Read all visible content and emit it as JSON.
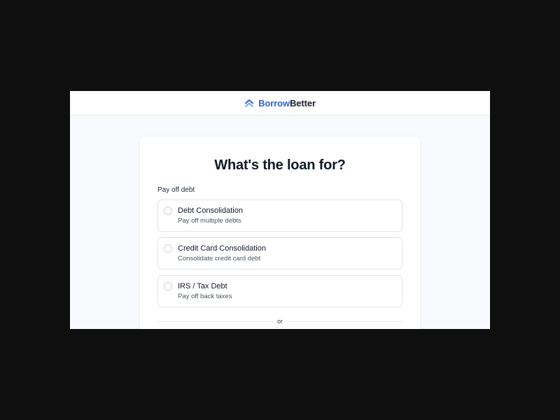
{
  "header": {
    "brand_part1": "Borrow",
    "brand_part2": "Better",
    "logo_icon": "double-chevron-up-icon"
  },
  "card": {
    "title": "What's the loan for?",
    "section_label": "Pay off debt",
    "options": [
      {
        "title": "Debt Consolidation",
        "subtitle": "Pay off multiple debts"
      },
      {
        "title": "Credit Card Consolidation",
        "subtitle": "Consolidate credit card debt"
      },
      {
        "title": "IRS / Tax Debt",
        "subtitle": "Pay off back taxes"
      }
    ],
    "divider_text": "or"
  },
  "colors": {
    "brand_blue": "#2f62d8",
    "brand_dark": "#1a1f2b",
    "page_bg": "#f7f9fc",
    "outer_bg": "#0f0f0f"
  }
}
